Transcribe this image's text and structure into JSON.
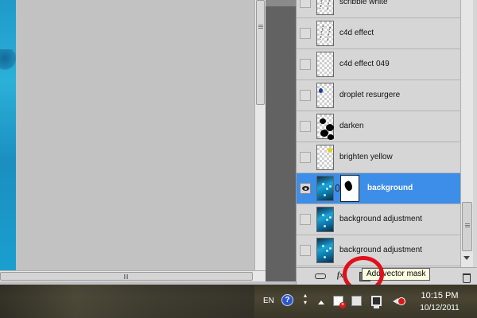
{
  "layers": [
    {
      "name": "scribble white",
      "visible": false,
      "thumb": "scribble",
      "selected": false
    },
    {
      "name": "c4d effect",
      "visible": false,
      "thumb": "scribble",
      "selected": false
    },
    {
      "name": "c4d effect 049",
      "visible": false,
      "thumb": "transparent",
      "selected": false
    },
    {
      "name": "droplet resurgere",
      "visible": false,
      "thumb": "dot-blue",
      "selected": false
    },
    {
      "name": "darken",
      "visible": false,
      "thumb": "blobs",
      "selected": false
    },
    {
      "name": "brighten yellow",
      "visible": false,
      "thumb": "dot-yellow",
      "selected": false
    },
    {
      "name": "background",
      "visible": true,
      "thumb": "blue",
      "selected": true,
      "has_mask": true
    },
    {
      "name": "background adjustment",
      "visible": false,
      "thumb": "blue",
      "selected": false
    },
    {
      "name": "background adjustment",
      "visible": false,
      "thumb": "blue",
      "selected": false
    }
  ],
  "footer": {
    "link_icon": "link-layers-icon",
    "fx_label": "fx",
    "mask_icon": "add-mask-icon",
    "trash_icon": "delete-layer-icon"
  },
  "tooltip": {
    "text": "Add vector mask"
  },
  "taskbar": {
    "language": "EN",
    "help_label": "?",
    "time": "10:15 PM",
    "date": "10/12/2011"
  },
  "colors": {
    "selected_row": "#3d8ee8",
    "highlight_circle": "#e0101a",
    "tooltip_bg": "#ffffe1"
  }
}
